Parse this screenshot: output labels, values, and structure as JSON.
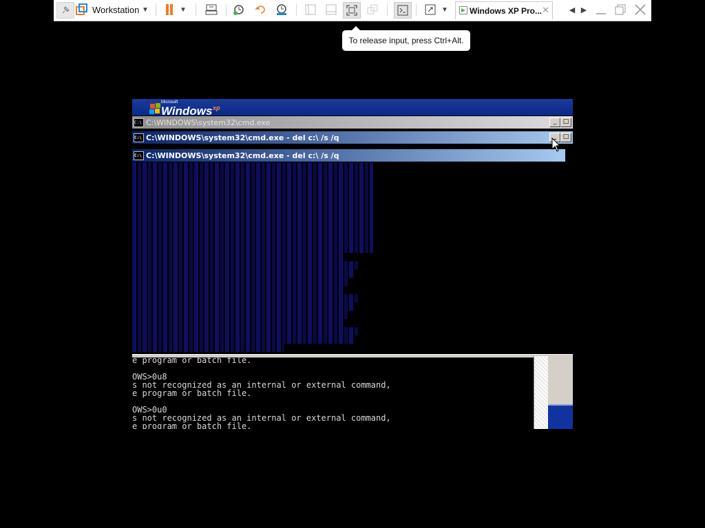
{
  "toolbar": {
    "product_label": "Workstation",
    "tab_label": "Windows XP Pro...",
    "accent_pause": "#f07b20",
    "icons": [
      "pin-icon",
      "workstation-logo-icon",
      "pause-icon",
      "send-keys-icon",
      "snapshot-icon",
      "revert-icon",
      "snapshot-manager-icon",
      "view-icon",
      "console-view-icon",
      "fullscreen-icon",
      "close-icon"
    ]
  },
  "tooltip": {
    "text": "To release input, press Ctrl+Alt."
  },
  "guest": {
    "xp_word": "Windows",
    "xp_ms": "Microsoft",
    "xp_suffix": "xp",
    "windows": [
      {
        "title": "C:\\WINDOWS\\system32\\cmd.exe",
        "active": false
      },
      {
        "title": "C:\\WINDOWS\\system32\\cmd.exe - del c:\\ /s /q",
        "active": true
      },
      {
        "title": "C:\\WINDOWS\\system32\\cmd.exe - del c:\\ /s /q",
        "active": true
      }
    ],
    "icon_text": "C:\\",
    "console_lines": [
      "e program or batch file.",
      "",
      "OWS>0u8",
      "s not recognized as an internal or external command,",
      "e program or batch file.",
      "",
      "OWS>0u0",
      "s not recognized as an internal or external command,",
      "e program or batch file."
    ]
  }
}
